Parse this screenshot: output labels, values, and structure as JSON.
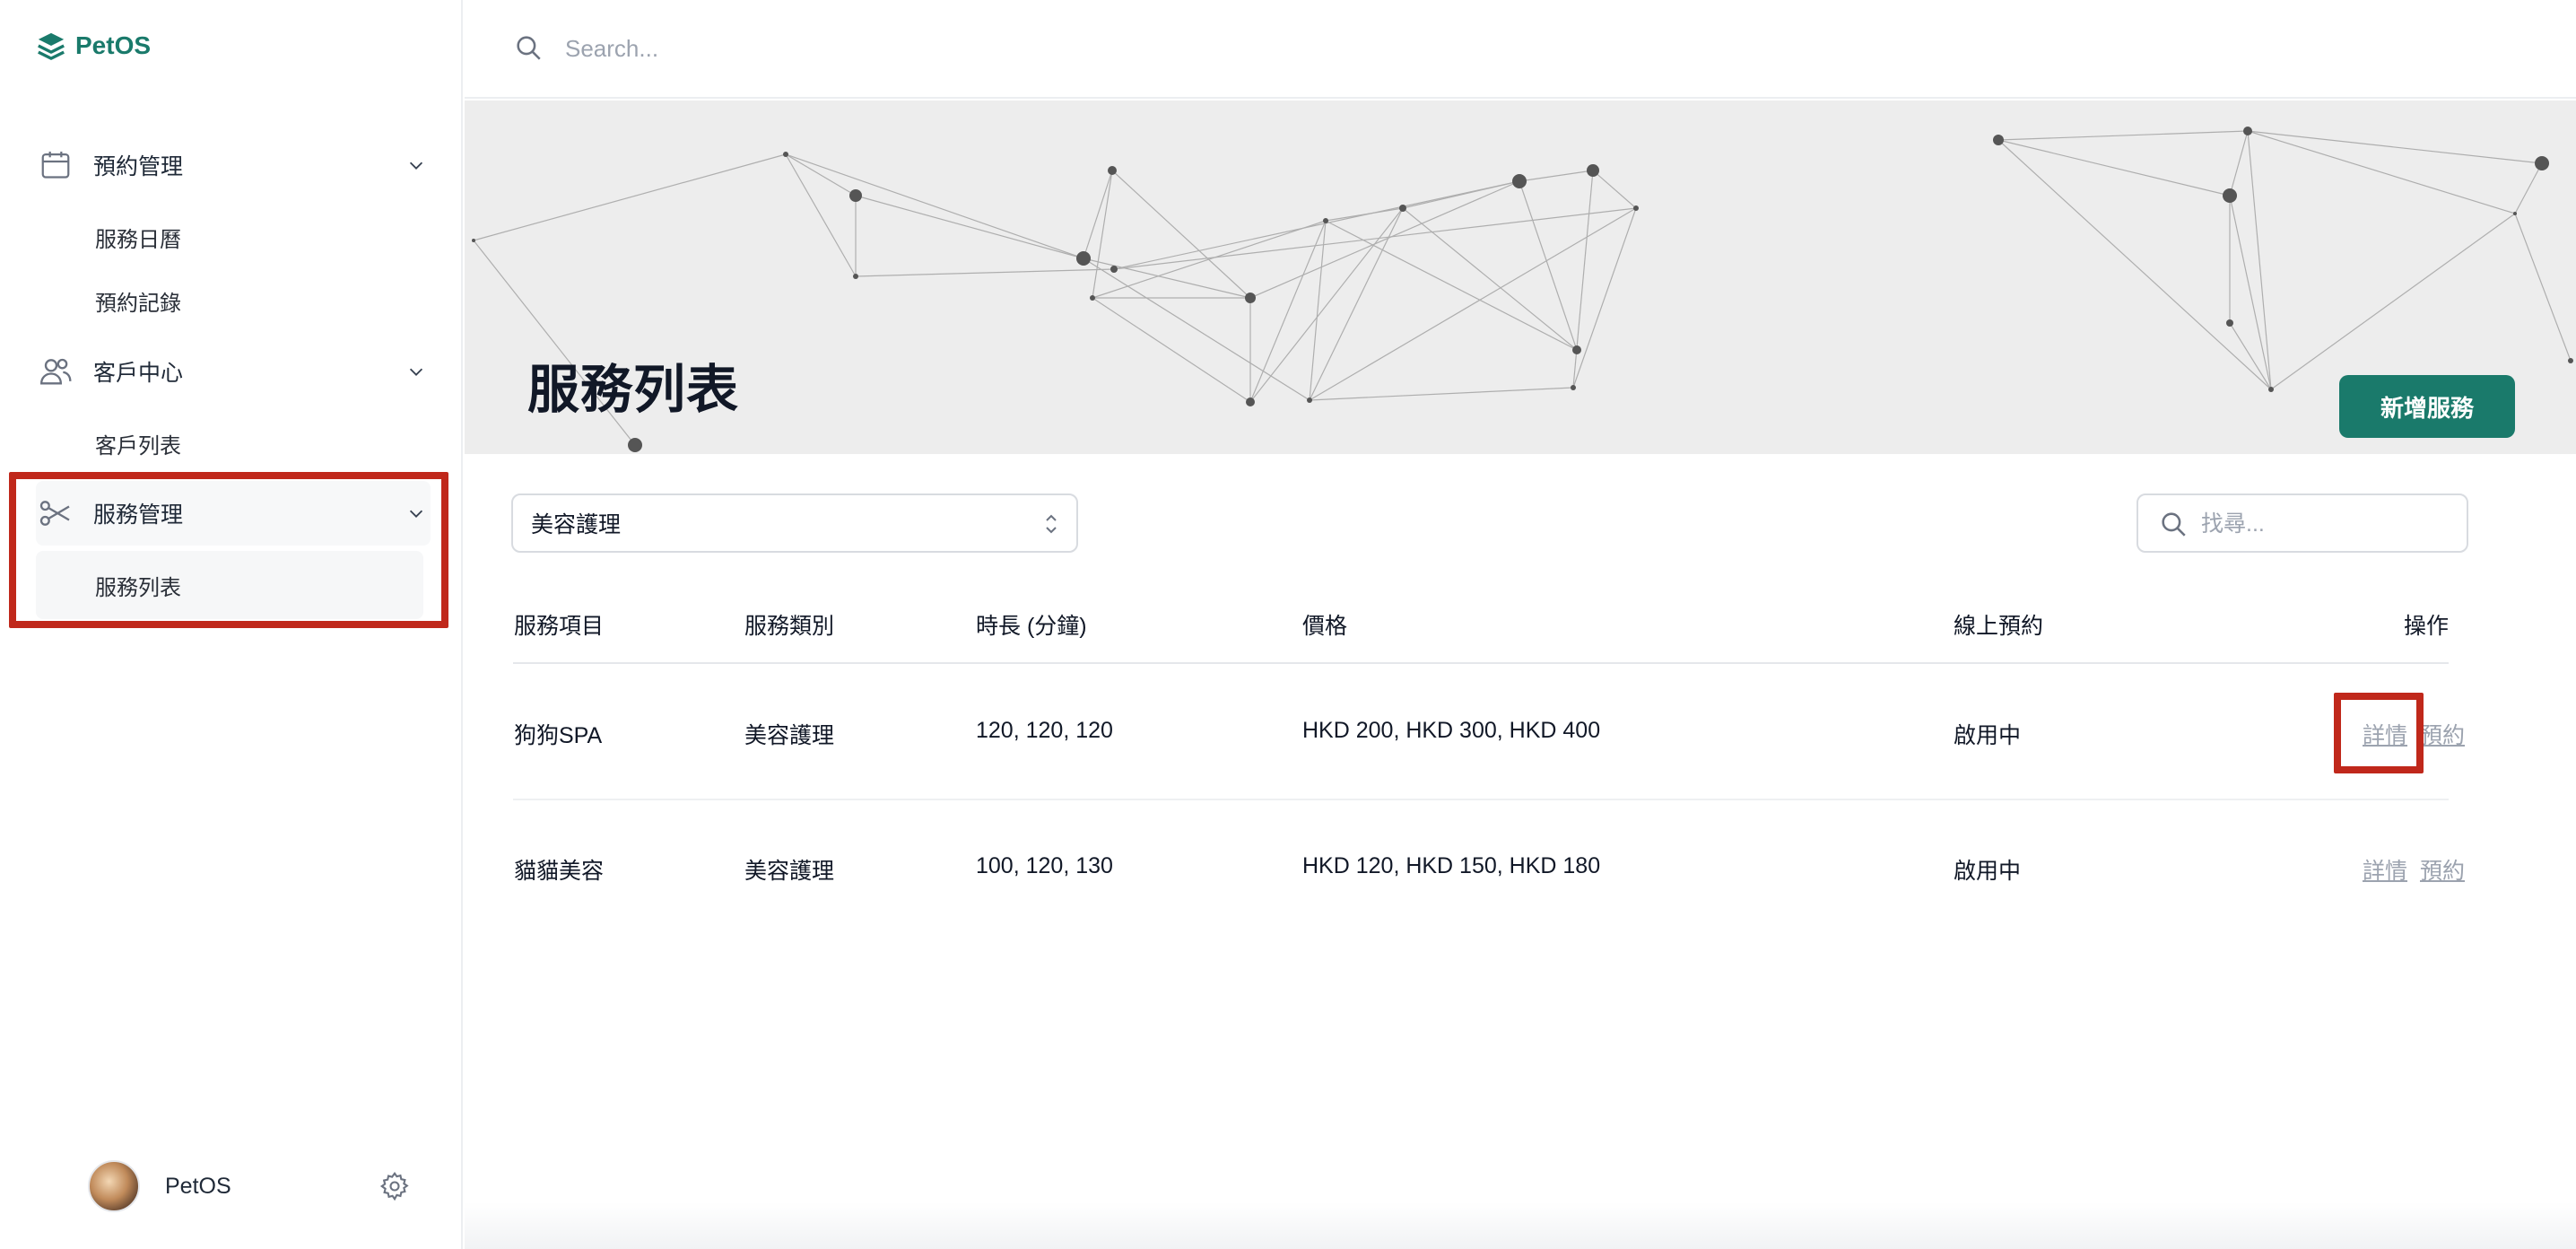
{
  "app": {
    "name": "PetOS"
  },
  "sidebar": {
    "groups": [
      {
        "label": "預約管理",
        "icon": "calendar-icon",
        "items": [
          "服務日曆",
          "預約記錄"
        ]
      },
      {
        "label": "客戶中心",
        "icon": "users-icon",
        "items": [
          "客戶列表"
        ]
      },
      {
        "label": "服務管理",
        "icon": "scissors-icon",
        "items": [
          "服務列表"
        ]
      }
    ],
    "footer": {
      "user_name": "PetOS"
    }
  },
  "topbar": {
    "search_placeholder": "Search..."
  },
  "page": {
    "title": "服務列表",
    "new_button": "新增服務"
  },
  "filters": {
    "category_selected": "美容護理",
    "search_placeholder": "找尋..."
  },
  "table": {
    "columns": [
      "服務項目",
      "服務類別",
      "時長 (分鐘)",
      "價格",
      "線上預約",
      "操作"
    ],
    "rows": [
      {
        "name": "狗狗SPA",
        "category": "美容護理",
        "duration": "120, 120, 120",
        "price": "HKD 200, HKD 300, HKD 400",
        "online": "啟用中",
        "detail": "詳情",
        "book": "預約"
      },
      {
        "name": "貓貓美容",
        "category": "美容護理",
        "duration": "100, 120, 130",
        "price": "HKD 120, HKD 150, HKD 180",
        "online": "啟用中",
        "detail": "詳情",
        "book": "預約"
      }
    ]
  },
  "colors": {
    "brand": "#1a7a6b",
    "highlight": "#c0281b"
  }
}
